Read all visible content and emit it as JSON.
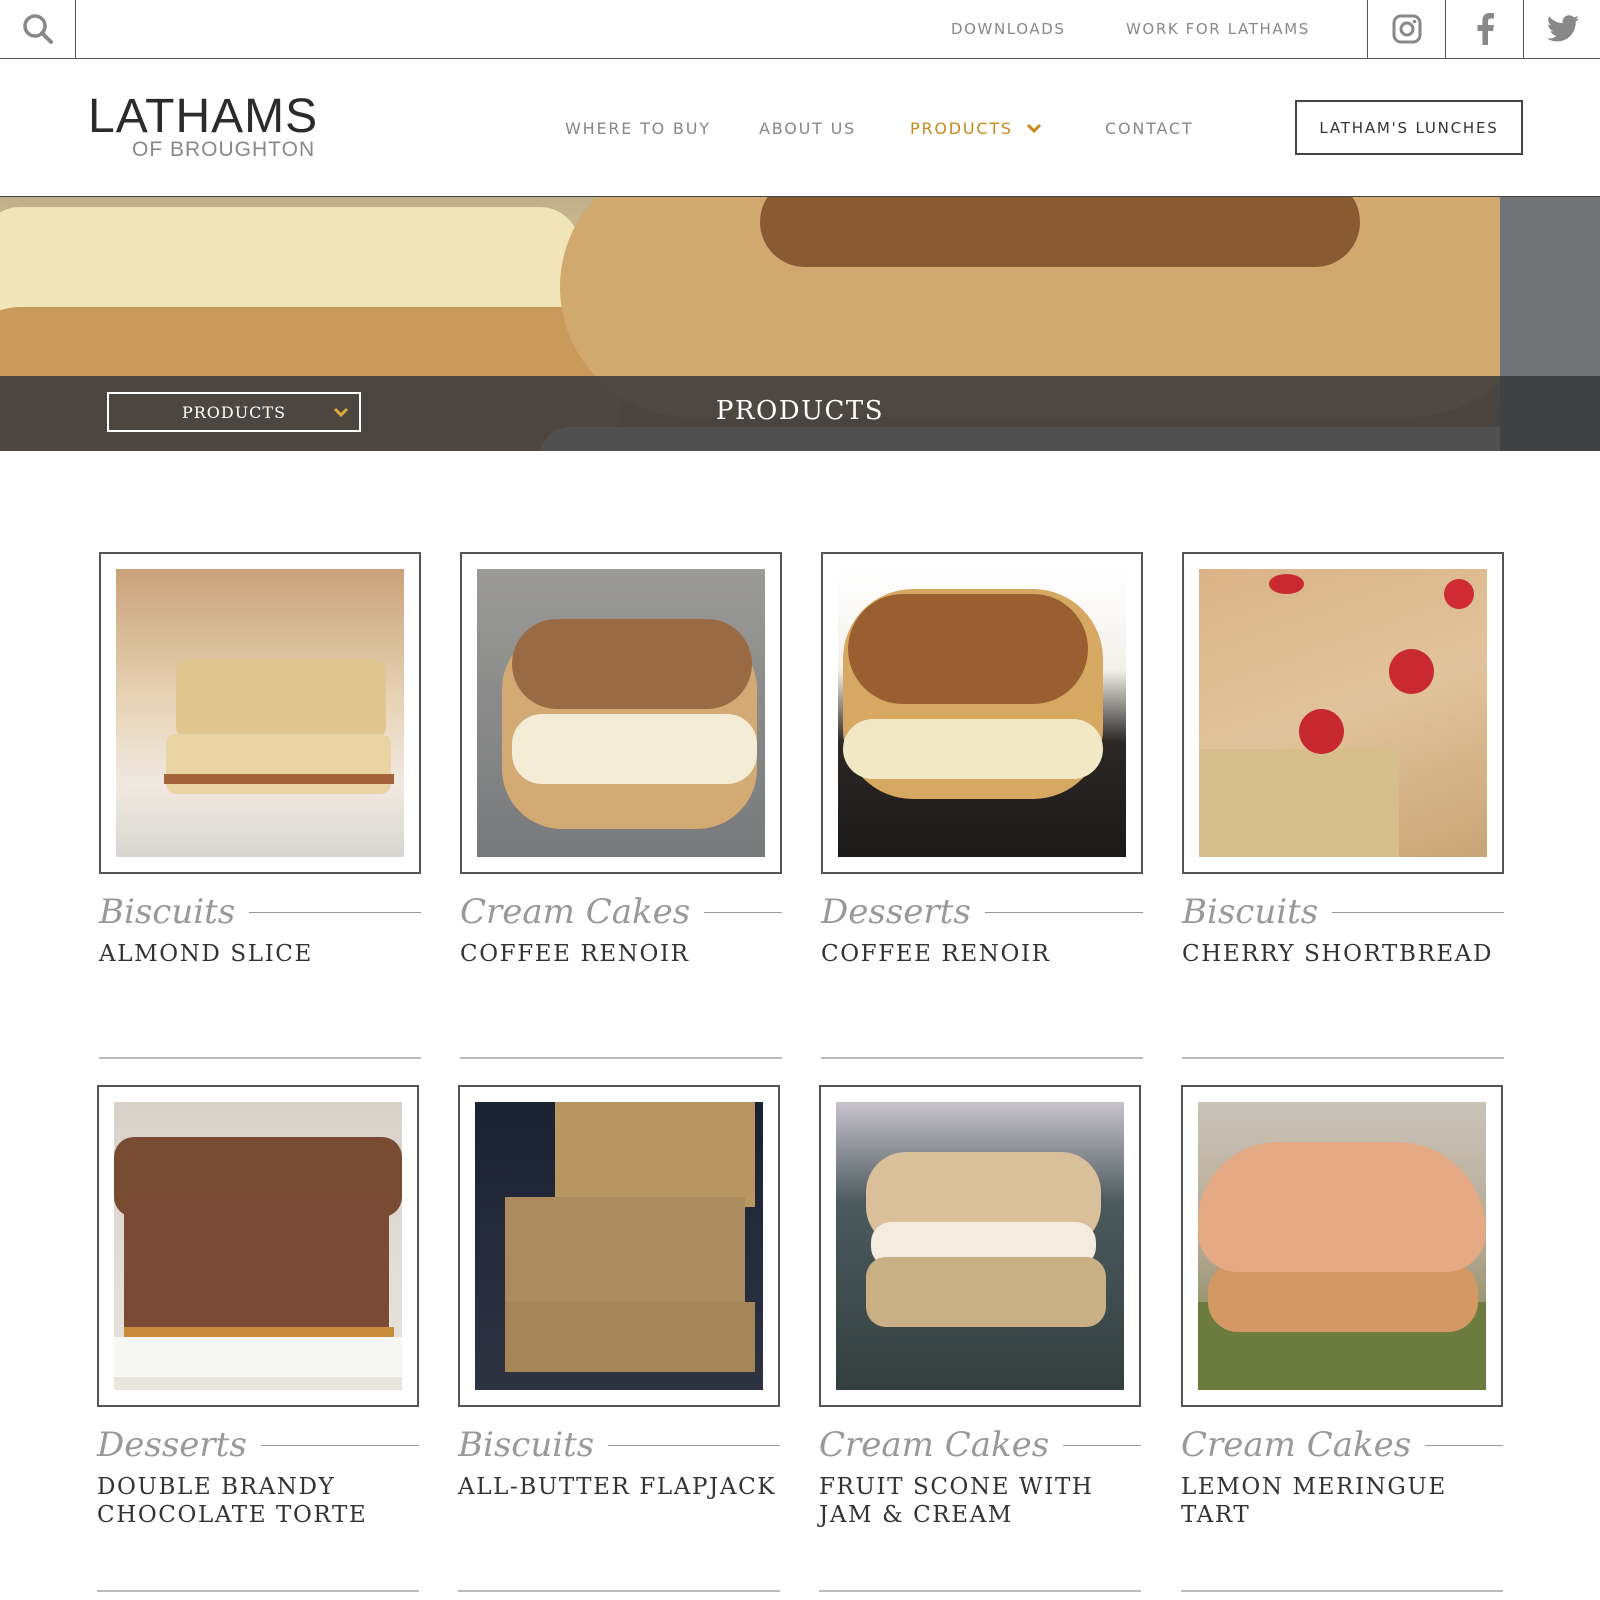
{
  "topbar": {
    "links": [
      "DOWNLOADS",
      "WORK FOR LATHAMS"
    ],
    "social": [
      "instagram-icon",
      "facebook-icon",
      "twitter-icon"
    ]
  },
  "header": {
    "logo_main": "LATHAMS",
    "logo_sub": "OF BROUGHTON",
    "nav": [
      "WHERE TO BUY",
      "ABOUT US",
      "PRODUCTS",
      "CONTACT"
    ],
    "cta": "LATHAM'S LUNCHES"
  },
  "hero": {
    "select_label": "PRODUCTS",
    "title": "PRODUCTS"
  },
  "products": [
    {
      "category": "Biscuits",
      "name": "ALMOND SLICE"
    },
    {
      "category": "Cream Cakes",
      "name": "COFFEE RENOIR"
    },
    {
      "category": "Desserts",
      "name": "COFFEE RENOIR"
    },
    {
      "category": "Biscuits",
      "name": "CHERRY SHORTBREAD"
    },
    {
      "category": "Desserts",
      "name": "DOUBLE BRANDY CHOCOLATE TORTE"
    },
    {
      "category": "Biscuits",
      "name": "ALL-BUTTER FLAPJACK"
    },
    {
      "category": "Cream Cakes",
      "name": "FRUIT SCONE WITH JAM & CREAM"
    },
    {
      "category": "Cream Cakes",
      "name": "LEMON MERINGUE TART"
    }
  ],
  "colors": {
    "accent": "#c78a1a",
    "band": "#3a3a3c"
  }
}
